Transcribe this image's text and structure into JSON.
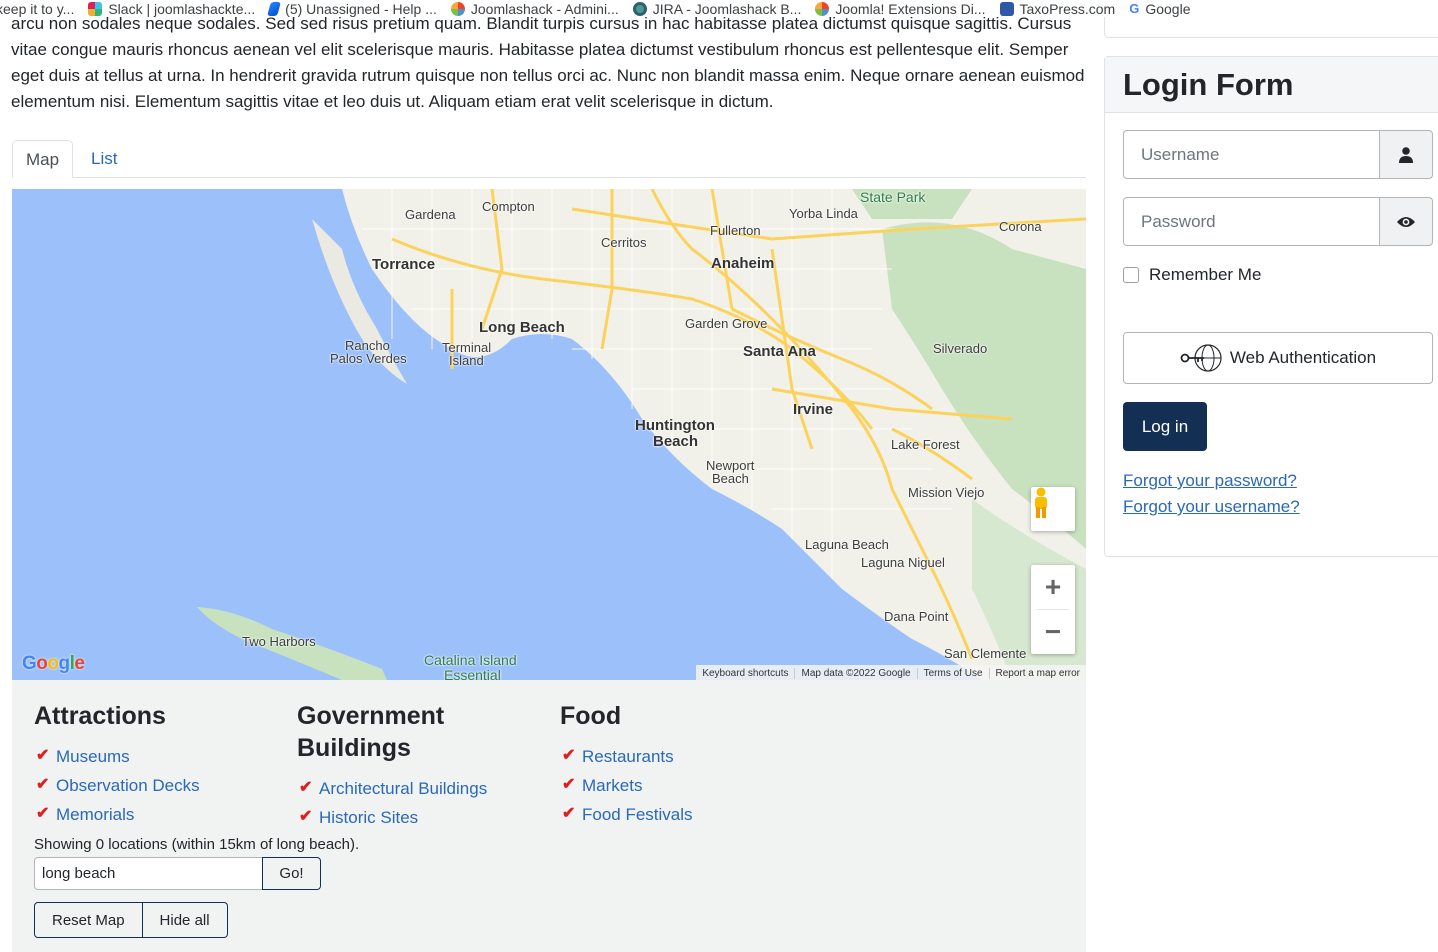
{
  "bookmarks": [
    {
      "label": "keep it to y...",
      "icon": "bookmark-icon"
    },
    {
      "label": "Slack | joomlashackte...",
      "icon": "slack-icon"
    },
    {
      "label": "(5) Unassigned - Help ...",
      "icon": "jira-icon"
    },
    {
      "label": "Joomlashack - Admini...",
      "icon": "joomla-icon"
    },
    {
      "label": "JIRA - Joomlashack B...",
      "icon": "jira-icon"
    },
    {
      "label": "Joomla! Extensions Di...",
      "icon": "joomla-icon"
    },
    {
      "label": "TaxoPress.com",
      "icon": "taxopress-icon"
    },
    {
      "label": "Google",
      "icon": "google-icon"
    }
  ],
  "content": {
    "paragraph": "arcu non sodales neque sodales. Sed sed risus pretium quam. Blandit turpis cursus in hac habitasse platea dictumst quisque sagittis. Cursus vitae congue mauris rhoncus aenean vel elit scelerisque mauris. Habitasse platea dictumst vestibulum rhoncus est pellentesque elit. Semper eget duis at tellus at urna. In hendrerit gravida rutrum quisque non tellus orci ac. Nunc non blandit massa enim. Neque ornare aenean euismod elementum nisi. Elementum sagittis vitae et leo duis ut. Aliquam etiam erat velit scelerisque in dictum."
  },
  "tabs": {
    "map": "Map",
    "list": "List"
  },
  "map": {
    "places": {
      "compton": "Compton",
      "gardena": "Gardena",
      "yorba_linda": "Yorba Linda",
      "state_park": "State Park",
      "corona": "Corona",
      "fullerton": "Fullerton",
      "cerritos": "Cerritos",
      "torrance": "Torrance",
      "anaheim": "Anaheim",
      "long_beach": "Long Beach",
      "garden_grove": "Garden Grove",
      "rancho": "Rancho",
      "palos_verdes": "Palos Verdes",
      "terminal": "Terminal",
      "island": "Island",
      "santa_ana": "Santa Ana",
      "silverado": "Silverado",
      "irvine": "Irvine",
      "huntington": "Huntington",
      "beach": "Beach",
      "lake_forest": "Lake Forest",
      "newport": "Newport",
      "newport_beach": "Beach",
      "mission_viejo": "Mission Viejo",
      "laguna_beach": "Laguna Beach",
      "laguna_niguel": "Laguna Niguel",
      "two_harbors": "Two Harbors",
      "catalina": "Catalina Island",
      "essential": "Essential",
      "dana_point": "Dana Point",
      "san_clemente": "San Clemente"
    },
    "google_logo": "Google",
    "attribution": {
      "shortcuts": "Keyboard shortcuts",
      "data": "Map data ©2022 Google",
      "terms": "Terms of Use",
      "report": "Report a map error"
    }
  },
  "categories": {
    "attractions": {
      "title": "Attractions",
      "items": [
        "Museums",
        "Observation Decks",
        "Memorials"
      ]
    },
    "government": {
      "title": "Government Buildings",
      "items": [
        "Architectural Buildings",
        "Historic Sites"
      ]
    },
    "food": {
      "title": "Food",
      "items": [
        "Restaurants",
        "Markets",
        "Food Festivals"
      ]
    }
  },
  "search": {
    "status": "Showing 0 locations (within 15km of long beach).",
    "value": "long beach",
    "go_label": "Go!",
    "reset_label": "Reset Map",
    "hide_label": "Hide all"
  },
  "login": {
    "title": "Login Form",
    "username_placeholder": "Username",
    "password_placeholder": "Password",
    "remember_label": "Remember Me",
    "webauth_label": "Web Authentication",
    "login_label": "Log in",
    "forgot_password": "Forgot your password?",
    "forgot_username": "Forgot your username?"
  },
  "colors": {
    "link": "#2a69b8",
    "primary": "#132f53",
    "water": "#9cc0f9",
    "land": "#f1f1ea",
    "park": "#c8e2c0",
    "highway": "#fbd35c"
  }
}
